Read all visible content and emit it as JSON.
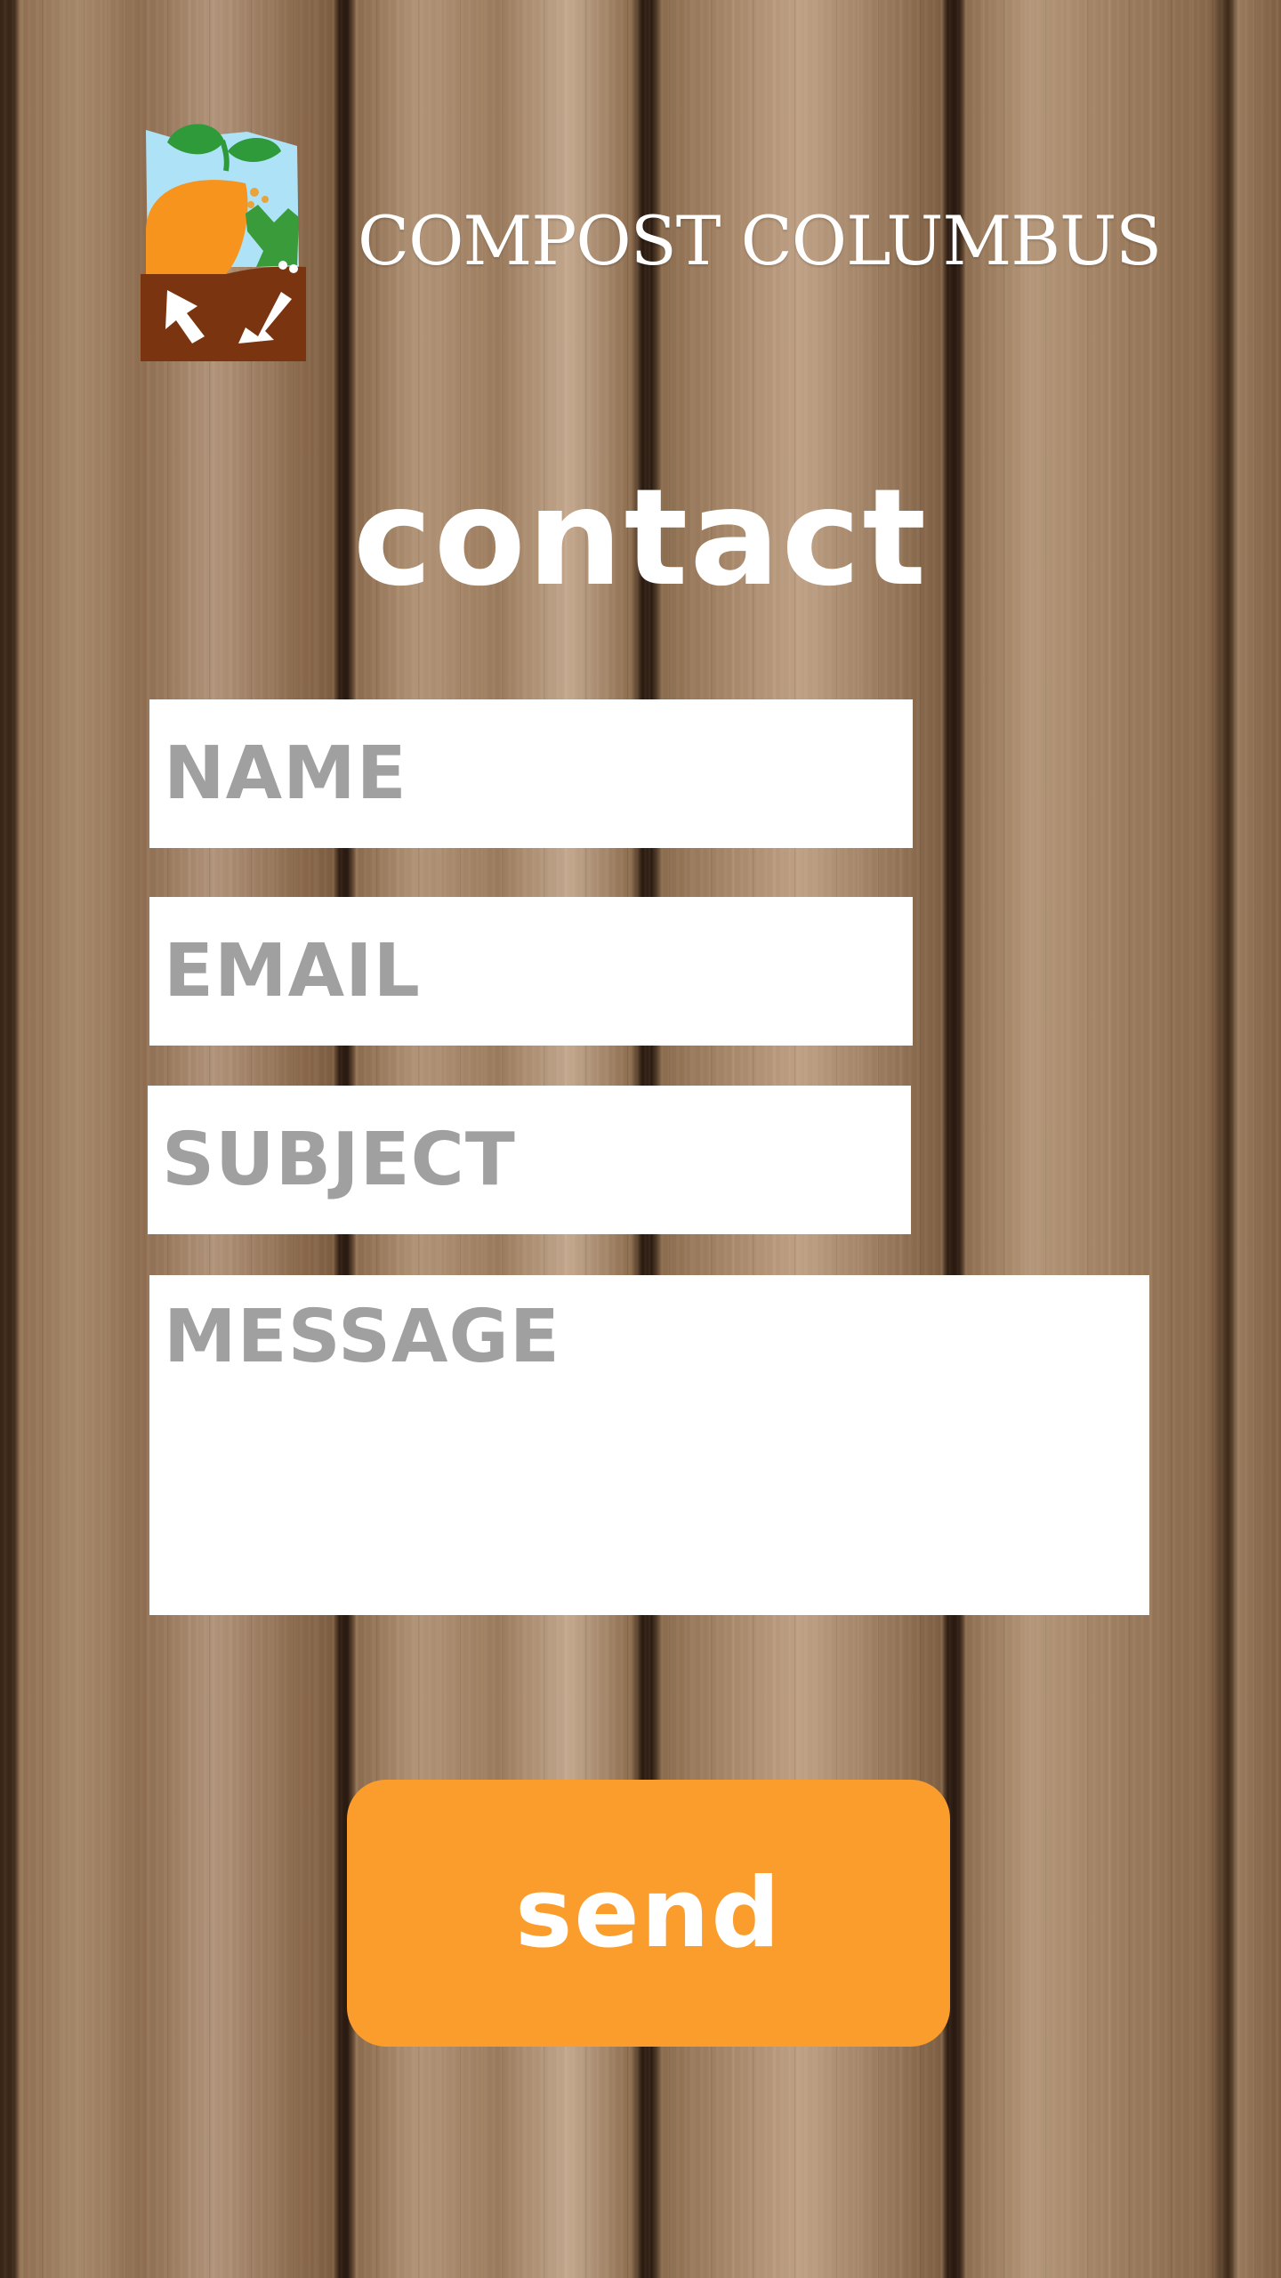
{
  "header": {
    "logo_icon": "compost-logo-icon",
    "brand_name": "COMPOST COLUMBUS"
  },
  "main": {
    "title": "contact"
  },
  "form": {
    "name": {
      "value": "",
      "placeholder": "NAME"
    },
    "email": {
      "value": "",
      "placeholder": "EMAIL"
    },
    "subject": {
      "value": "",
      "placeholder": "SUBJECT"
    },
    "message": {
      "value": "",
      "placeholder": "MESSAGE"
    },
    "send_label": "send"
  },
  "colors": {
    "accent": "#fb9d2c",
    "field_background": "#ffffff",
    "placeholder": "#a0a0a0",
    "logo_sky": "#aee3f7",
    "logo_leaf": "#2f9a3a",
    "logo_orange": "#f7941d",
    "logo_soil": "#7a3510"
  }
}
